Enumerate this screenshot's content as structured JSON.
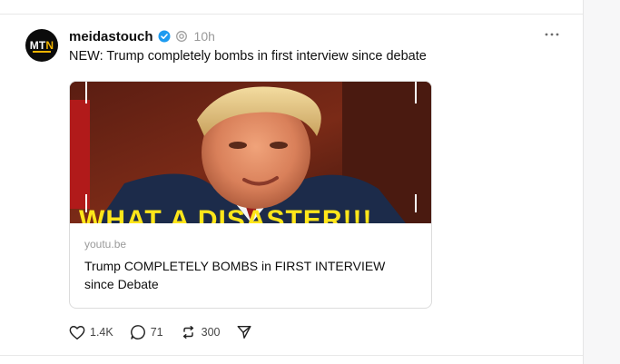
{
  "post": {
    "author": {
      "username": "meidastouch",
      "avatar_text": "MTN",
      "verified": true
    },
    "timestamp": "10h",
    "text": "NEW: Trump completely bombs in first interview since debate",
    "link_card": {
      "thumbnail_caption": "WHAT A DISASTER!!!",
      "domain": "youtu.be",
      "title": "Trump COMPLETELY BOMBS in FIRST INTERVIEW since Debate"
    },
    "actions": {
      "likes": "1.4K",
      "replies": "71",
      "reposts": "300"
    }
  },
  "icons": {
    "like": "heart-icon",
    "reply": "speech-bubble-icon",
    "repost": "repost-arrows-icon",
    "share": "send-icon",
    "more": "ellipsis-icon",
    "verified": "verified-badge-icon"
  },
  "colors": {
    "verified_badge": "#1d9bf0",
    "thumbnail_caption": "#ffe61a",
    "text_muted": "#999999"
  }
}
